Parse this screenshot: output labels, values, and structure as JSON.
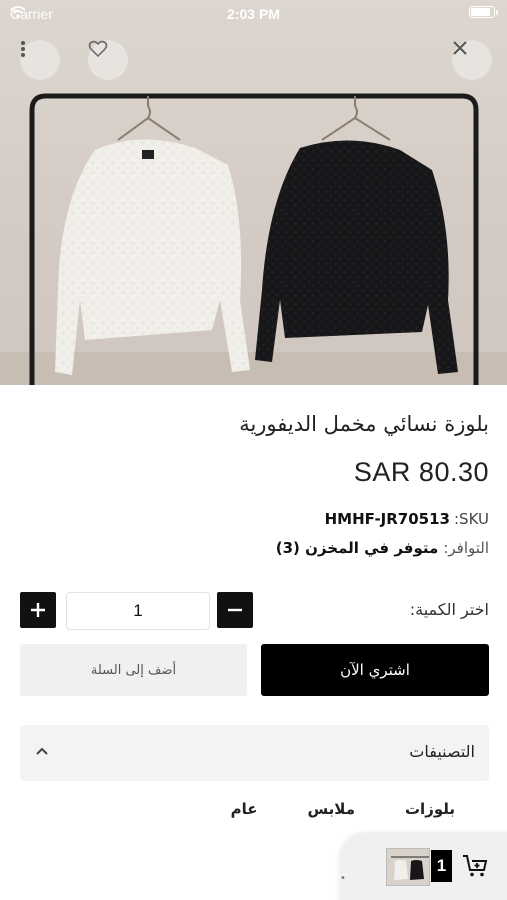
{
  "status_bar": {
    "carrier": "Carrier",
    "time": "2:03 PM",
    "battery_level": 0.9
  },
  "header_icons": {
    "more": "more-vertical-icon",
    "favorite": "heart-icon",
    "close": "close-icon"
  },
  "product": {
    "title": "بلوزة نسائي مخمل الديفورية",
    "price": "SAR 80.30",
    "sku_label": ":SKU",
    "sku_value": "HMHF-JR70513",
    "availability_label": "التوافر:",
    "availability_value": "متوفر في المخزن (3)"
  },
  "quantity": {
    "label": "اختر الكمية:",
    "value": "1",
    "plus": "+",
    "minus": "−"
  },
  "actions": {
    "buy_now": "اشتري الآن",
    "add_to_cart": "أضف إلى السلة"
  },
  "categories": {
    "title": "التصنيفات",
    "items": [
      "عام",
      "ملابس",
      "بلوزات"
    ]
  },
  "floating_cart": {
    "count": "1",
    "icon": "add-to-cart-icon",
    "dot": "•"
  },
  "colors": {
    "primary": "#000000",
    "secondary_button": "#eef0f2",
    "accordion_bg": "#f3f3f3"
  }
}
